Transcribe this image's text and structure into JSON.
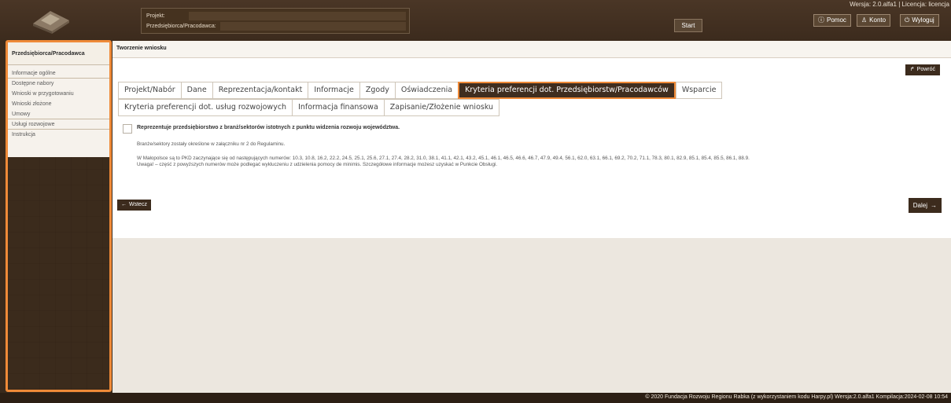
{
  "header": {
    "project_label": "Projekt:",
    "employer_label": "Przedsiębiorca/Pracodawca:",
    "start_button": "Start",
    "version_text": "Wersja: 2.0.alfa1 | Licencja: licencja",
    "help_button": "Pomoc",
    "account_button": "Konto",
    "logout_button": "Wyloguj"
  },
  "sidebar": {
    "heading": "Przedsiębiorca/Pracodawca",
    "items": [
      {
        "label": "Informacje ogólne"
      },
      {
        "label": "Dostępne nabory"
      },
      {
        "label": "Wnioski w przygotowaniu"
      },
      {
        "label": "Wnioski złożone"
      },
      {
        "label": "Umowy"
      },
      {
        "label": "Usługi rozwojowe"
      },
      {
        "label": "Instrukcja"
      }
    ]
  },
  "breadcrumb": "Tworzenie wniosku",
  "back_top_button": "Powróć",
  "tabs_row1": [
    {
      "label": "Projekt/Nabór"
    },
    {
      "label": "Dane"
    },
    {
      "label": "Reprezentacja/kontakt"
    },
    {
      "label": "Informacje"
    },
    {
      "label": "Zgody"
    },
    {
      "label": "Oświadczenia"
    },
    {
      "label": "Kryteria preferencji dot. Przedsiębiorstw/Pracodawców"
    },
    {
      "label": "Wsparcie"
    }
  ],
  "tabs_row2": [
    {
      "label": "Kryteria preferencji dot. usług rozwojowych"
    },
    {
      "label": "Informacja finansowa"
    },
    {
      "label": "Zapisanie/Złożenie wniosku"
    }
  ],
  "active_tab": "Kryteria preferencji dot. Przedsiębiorstw/Pracodawców",
  "form": {
    "checkbox_label": "Reprezentuje przedsiębiorstwo z branż/sektorów istotnych z punktu widzenia rozwoju województwa.",
    "checked": false,
    "note1": "Branże/sektory zostały określone w załączniku nr 2 do Regulaminu.",
    "note2": "W Małopolsce są to PKD zaczynające się od następujących numerów: 10.3, 10.8, 16.2, 22.2, 24.5, 25.1, 25.6, 27.1, 27.4, 28.2, 31.0, 38.1, 41.1, 42.1, 43.2, 45.1, 46.1, 46.5, 46.6, 46.7, 47.9, 49.4, 56.1, 62.0, 63.1, 66.1, 69.2, 70.2, 71.1, 78.3, 80.1, 82.9, 85.1, 85.4, 85.5, 86.1, 88.9.",
    "note3": "Uwaga! – część z powyższych numerów może podlegać wykluczeniu z udzielenia pomocy de minimis. Szczegółowe informacje możesz uzyskać w Punkcie Obsługi."
  },
  "nav": {
    "back_button": "Wstecz",
    "next_button": "Dalej"
  },
  "footer_text": "© 2020 Fundacja Rozwoju Regionu Rabka (z wykorzystaniem kodu Harpy.pl) Wersja:2.0.alfa1 Kompilacja:2024-02-08 10:54",
  "colors": {
    "accent_orange": "#ef8a38",
    "dark_brown": "#3c2b1d"
  }
}
